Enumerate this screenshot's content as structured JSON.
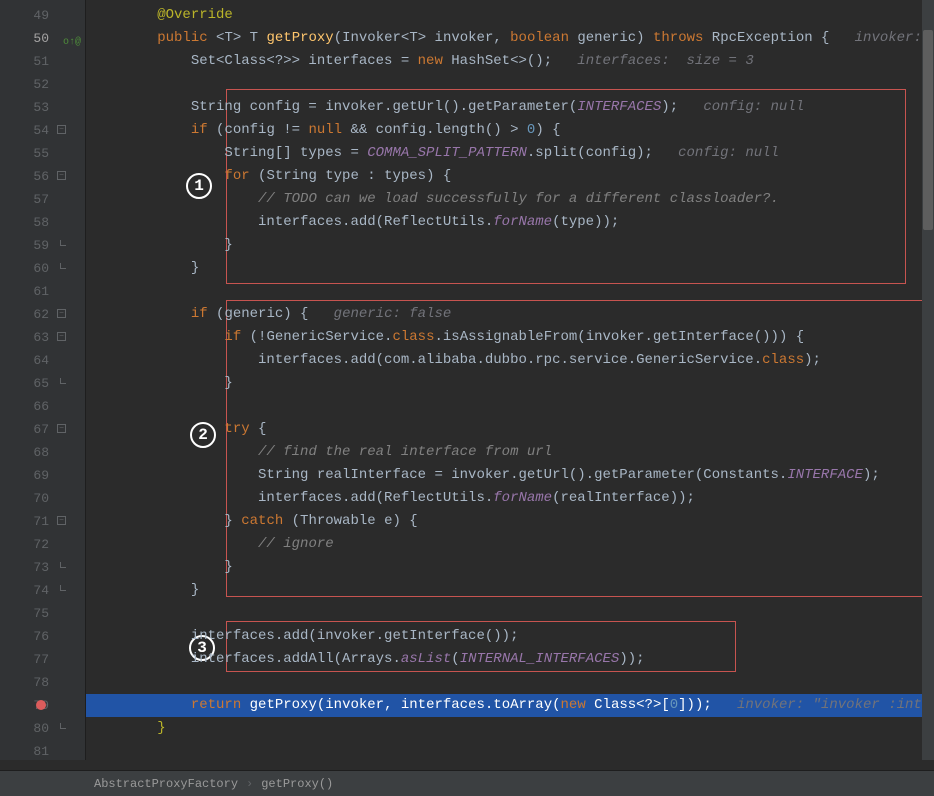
{
  "lines": [
    {
      "n": "49",
      "html": "        <span class='k-annotation'>@Override</span>"
    },
    {
      "n": "50",
      "hl": true,
      "override": true,
      "html": "        <span class='k-keyword'>public</span> &lt;<span class='k-type'>T</span>&gt; <span class='k-type'>T</span> <span class='k-method'>getProxy</span>(Invoker&lt;<span class='k-type'>T</span>&gt; invoker, <span class='k-keyword'>boolean</span> generic) <span class='k-keyword'>throws</span> RpcException {   <span class='k-inline'>invoker:</span>"
    },
    {
      "n": "51",
      "html": "            Set&lt;Class&lt;?&gt;&gt; interfaces = <span class='k-keyword'>new</span> HashSet&lt;&gt;();   <span class='k-inline'>interfaces:  size = 3</span>"
    },
    {
      "n": "52",
      "html": ""
    },
    {
      "n": "53",
      "html": "            String config = invoker.getUrl().getParameter(<span class='k-static'>INTERFACES</span>);   <span class='k-inline'>config: null</span>"
    },
    {
      "n": "54",
      "fold": true,
      "html": "            <span class='k-keyword'>if</span> (config != <span class='k-keyword'>null</span> && config.length() &gt; <span class='k-number'>0</span>) {"
    },
    {
      "n": "55",
      "html": "                String[] types = <span class='k-static'>COMMA_SPLIT_PATTERN</span>.split(config);   <span class='k-inline'>config: null</span>"
    },
    {
      "n": "56",
      "fold": true,
      "html": "                <span class='k-keyword'>for</span> (String type : types) {"
    },
    {
      "n": "57",
      "html": "                    <span class='k-comment'>// TODO can we load successfully for a different classloader?.</span>"
    },
    {
      "n": "58",
      "html": "                    interfaces.add(ReflectUtils.<span class='k-static'>forName</span>(type));"
    },
    {
      "n": "59",
      "foldc": true,
      "html": "                }"
    },
    {
      "n": "60",
      "foldc": true,
      "html": "            }"
    },
    {
      "n": "61",
      "html": ""
    },
    {
      "n": "62",
      "fold": true,
      "html": "            <span class='k-keyword'>if</span> (generic) {   <span class='k-inline'>generic: false</span>"
    },
    {
      "n": "63",
      "fold": true,
      "html": "                <span class='k-keyword'>if</span> (!GenericService.<span class='k-keyword'>class</span>.isAssignableFrom(invoker.getInterface())) {"
    },
    {
      "n": "64",
      "html": "                    interfaces.add(com.alibaba.dubbo.rpc.service.GenericService.<span class='k-keyword'>class</span>);"
    },
    {
      "n": "65",
      "foldc": true,
      "html": "                }"
    },
    {
      "n": "66",
      "html": ""
    },
    {
      "n": "67",
      "fold": true,
      "html": "                <span class='k-keyword'>try</span> {"
    },
    {
      "n": "68",
      "html": "                    <span class='k-comment'>// find the real interface from url</span>"
    },
    {
      "n": "69",
      "html": "                    String realInterface = invoker.getUrl().getParameter(Constants.<span class='k-static'>INTERFACE</span>);"
    },
    {
      "n": "70",
      "html": "                    interfaces.add(ReflectUtils.<span class='k-static'>forName</span>(realInterface));"
    },
    {
      "n": "71",
      "fold": true,
      "html": "                } <span class='k-keyword'>catch</span> (Throwable e) {"
    },
    {
      "n": "72",
      "html": "                    <span class='k-comment'>// ignore</span>"
    },
    {
      "n": "73",
      "foldc": true,
      "html": "                }"
    },
    {
      "n": "74",
      "foldc": true,
      "html": "            }"
    },
    {
      "n": "75",
      "html": ""
    },
    {
      "n": "76",
      "html": "            interfaces.add(invoker.getInterface());"
    },
    {
      "n": "77",
      "html": "            interfaces.addAll(Arrays.<span class='k-static'>asList</span>(<span class='k-static'>INTERNAL_INTERFACES</span>));"
    },
    {
      "n": "78",
      "html": ""
    },
    {
      "n": "79",
      "bp": true,
      "exec": true,
      "html": "            <span class='k-keyword'>return</span> getProxy(invoker, interfaces.toArray(<span class='k-keyword'>new</span> Class&lt;?&gt;[<span class='k-number'>0</span>]));   <span class='k-inline'>invoker: \"invoker :inte</span>"
    },
    {
      "n": "80",
      "foldc": true,
      "html": "        <span class='k-annotation'>}</span>"
    },
    {
      "n": "81",
      "html": ""
    }
  ],
  "markers": {
    "c1": "1",
    "c2": "2",
    "c3": "3"
  },
  "breadcrumb": {
    "class": "AbstractProxyFactory",
    "method": "getProxy()"
  }
}
